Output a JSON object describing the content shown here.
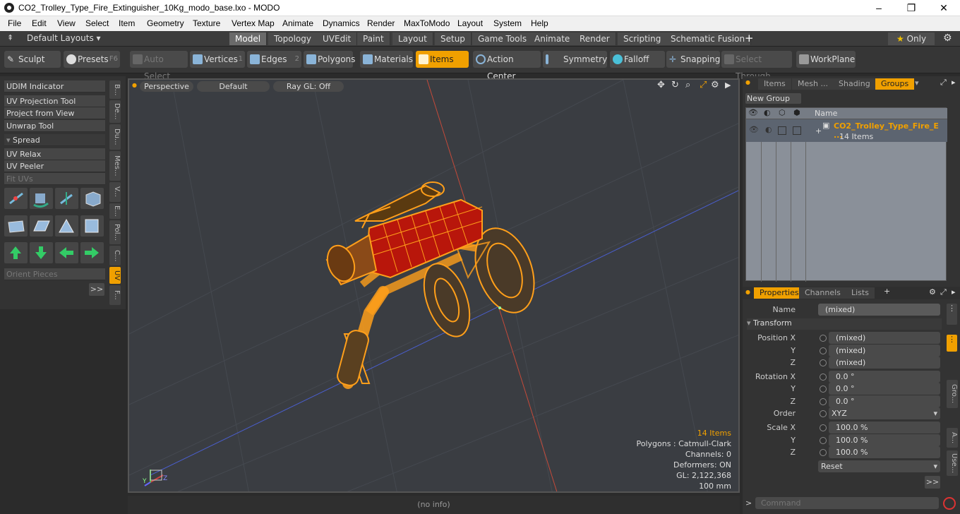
{
  "window": {
    "title": "CO2_Trolley_Type_Fire_Extinguisher_10Kg_modo_base.lxo - MODO"
  },
  "menu": [
    "File",
    "Edit",
    "View",
    "Select",
    "Item",
    "Geometry",
    "Texture",
    "Vertex Map",
    "Animate",
    "Dynamics",
    "Render",
    "MaxToModo",
    "Layout",
    "System",
    "Help"
  ],
  "layouts": {
    "label": "Default Layouts",
    "tabs": [
      "Model",
      "Topology",
      "UVEdit",
      "Paint",
      "Layout",
      "Setup",
      "Game Tools",
      "Animate",
      "Render",
      "Scripting",
      "Schematic Fusion"
    ],
    "active": "Model",
    "only": "Only"
  },
  "toolbar": {
    "sculpt": "Sculpt",
    "presets": "Presets",
    "presets_key": "F6",
    "auto_select": "Auto Select",
    "vertices": "Vertices",
    "vertices_num": "1",
    "edges": "Edges",
    "edges_num": "2",
    "polygons": "Polygons",
    "materials": "Materials",
    "items": "Items",
    "action_center": "Action Center",
    "symmetry": "Symmetry",
    "falloff": "Falloff",
    "snapping": "Snapping",
    "select_through": "Select Through",
    "workplane": "WorkPlane"
  },
  "left": {
    "tools": [
      "UDIM Indicator",
      "UV Projection Tool",
      "Project from View",
      "Unwrap Tool"
    ],
    "spread": "Spread",
    "tools2": [
      "UV Relax",
      "UV Peeler",
      "Fit UVs"
    ],
    "orient": "Orient Pieces",
    "more": ">>",
    "vtabs": [
      "B...",
      "De...",
      "Du...",
      "Mes...",
      "V...",
      "E...",
      "Pol...",
      "C...",
      "UV",
      "F..."
    ]
  },
  "viewport": {
    "perspective": "Perspective",
    "default": "Default",
    "raygl": "Ray GL: Off",
    "info": {
      "items": "14 Items",
      "polygons": "Polygons : Catmull-Clark",
      "channels": "Channels: 0",
      "deformers": "Deformers: ON",
      "gl": "GL: 2,122,368",
      "scale": "100 mm"
    },
    "axis": {
      "y": "Y",
      "z": "Z"
    }
  },
  "status": "(no info)",
  "groups": {
    "tabs": [
      "Items",
      "Mesh ...",
      "Shading",
      "Groups"
    ],
    "active": "Groups",
    "new_group": "New Group",
    "name_col": "Name",
    "row_name": "CO2_Trolley_Type_Fire_E ...",
    "row_sub": "14 Items"
  },
  "props": {
    "tabs": [
      "Properties",
      "Channels",
      "Lists"
    ],
    "active": "Properties",
    "name_label": "Name",
    "name_value": "(mixed)",
    "transform": "Transform",
    "position_x": "Position X",
    "y": "Y",
    "z": "Z",
    "pos_x": "(mixed)",
    "pos_y": "(mixed)",
    "pos_z": "(mixed)",
    "rotation_x": "Rotation X",
    "rot_x": "0.0 °",
    "rot_y": "0.0 °",
    "rot_z": "0.0 °",
    "order_label": "Order",
    "order": "XYZ",
    "scale_x": "Scale X",
    "sc_x": "100.0 %",
    "sc_y": "100.0 %",
    "sc_z": "100.0 %",
    "reset": "Reset",
    "more": ">>",
    "side_tabs": [
      "Gro...",
      "A...",
      "Use..."
    ]
  },
  "command": {
    "placeholder": "Command",
    "prompt": ">"
  },
  "colors": {
    "accent": "#f0a000",
    "wire": "#ff9f1a",
    "body": "#c0180c"
  }
}
